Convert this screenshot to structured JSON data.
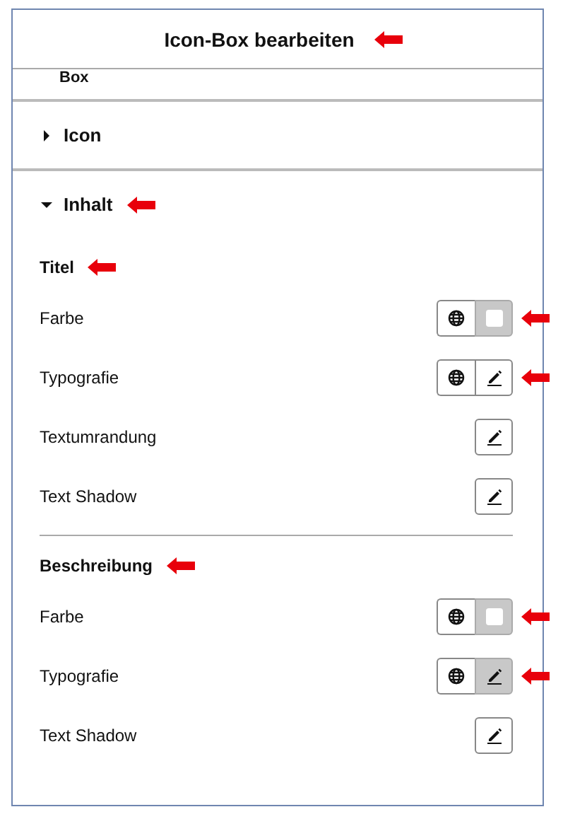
{
  "header": {
    "title": "Icon-Box bearbeiten",
    "arrow": true
  },
  "clipped_section": {
    "label": "Box"
  },
  "sections": [
    {
      "label": "Icon",
      "expanded": false,
      "arrow": false
    },
    {
      "label": "Inhalt",
      "expanded": true,
      "arrow": true,
      "groups": [
        {
          "heading": "Titel",
          "arrow": true,
          "controls": [
            {
              "label": "Farbe",
              "kind": "color",
              "global": true,
              "active": true,
              "arrow": true
            },
            {
              "label": "Typografie",
              "kind": "edit",
              "global": true,
              "active": false,
              "arrow": true
            },
            {
              "label": "Textumrandung",
              "kind": "edit",
              "global": false,
              "active": false,
              "arrow": false
            },
            {
              "label": "Text Shadow",
              "kind": "edit",
              "global": false,
              "active": false,
              "arrow": false
            }
          ]
        },
        {
          "heading": "Beschreibung",
          "arrow": true,
          "controls": [
            {
              "label": "Farbe",
              "kind": "color",
              "global": true,
              "active": true,
              "arrow": true
            },
            {
              "label": "Typografie",
              "kind": "edit",
              "global": true,
              "active": true,
              "arrow": true
            },
            {
              "label": "Text Shadow",
              "kind": "edit",
              "global": false,
              "active": false,
              "arrow": false
            }
          ]
        }
      ]
    }
  ]
}
